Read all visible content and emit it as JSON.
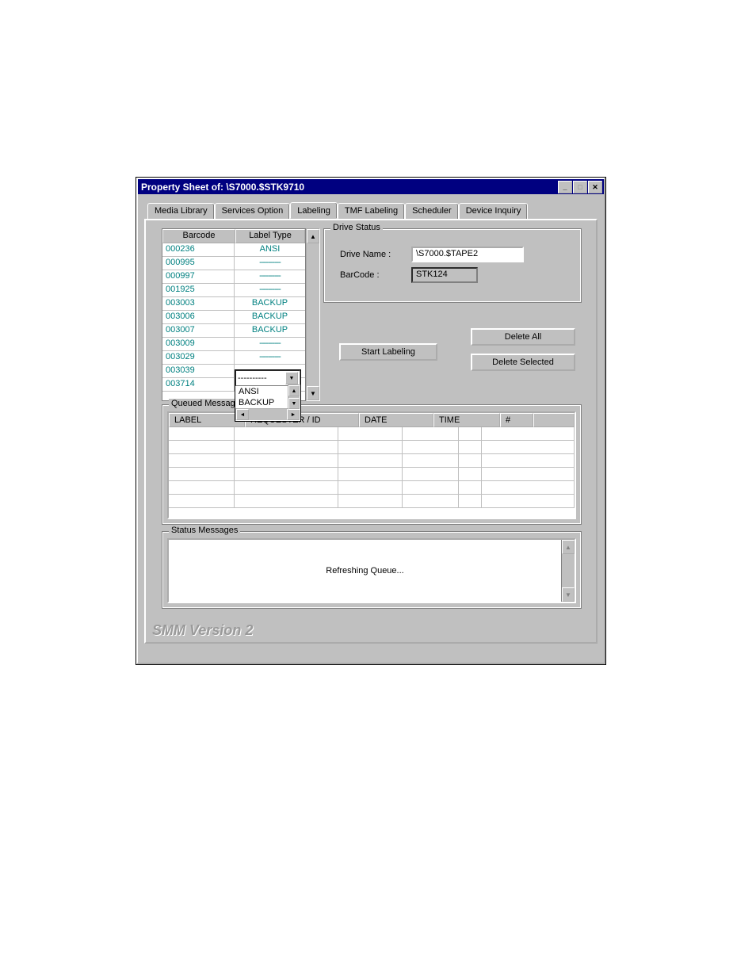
{
  "window": {
    "title": "Property Sheet of: \\S7000.$STK9710"
  },
  "tabs": [
    "Media Library",
    "Services Option",
    "Labeling",
    "TMF Labeling",
    "Scheduler",
    "Device Inquiry"
  ],
  "barcode_table": {
    "headers": [
      "Barcode",
      "Label Type"
    ],
    "rows": [
      {
        "barcode": "000236",
        "label_type": "ANSI"
      },
      {
        "barcode": "000995",
        "label_type": "----------"
      },
      {
        "barcode": "000997",
        "label_type": "----------"
      },
      {
        "barcode": "001925",
        "label_type": "----------"
      },
      {
        "barcode": "003003",
        "label_type": "BACKUP"
      },
      {
        "barcode": "003006",
        "label_type": "BACKUP"
      },
      {
        "barcode": "003007",
        "label_type": "BACKUP"
      },
      {
        "barcode": "003009",
        "label_type": "----------"
      },
      {
        "barcode": "003029",
        "label_type": "----------"
      },
      {
        "barcode": "003039",
        "label_type": ""
      },
      {
        "barcode": "003714",
        "label_type": ""
      }
    ]
  },
  "label_type_dropdown": {
    "selected": "----------",
    "options": [
      "ANSI",
      "BACKUP"
    ]
  },
  "drive_status": {
    "legend": "Drive Status",
    "drive_name_label": "Drive Name :",
    "drive_name_value": "\\S7000.$TAPE2",
    "barcode_label": "BarCode :",
    "barcode_value": "STK124"
  },
  "buttons": {
    "start_labeling": "Start Labeling",
    "delete_all": "Delete All",
    "delete_selected": "Delete Selected"
  },
  "queued_messages": {
    "legend": "Queued Messages",
    "headers": [
      "LABEL",
      "REQUESTER / ID",
      "DATE",
      "TIME",
      "#"
    ],
    "rows": []
  },
  "status_messages": {
    "legend": "Status Messages",
    "text": "Refreshing Queue..."
  },
  "footer": {
    "brand": "SMM Version 2"
  }
}
